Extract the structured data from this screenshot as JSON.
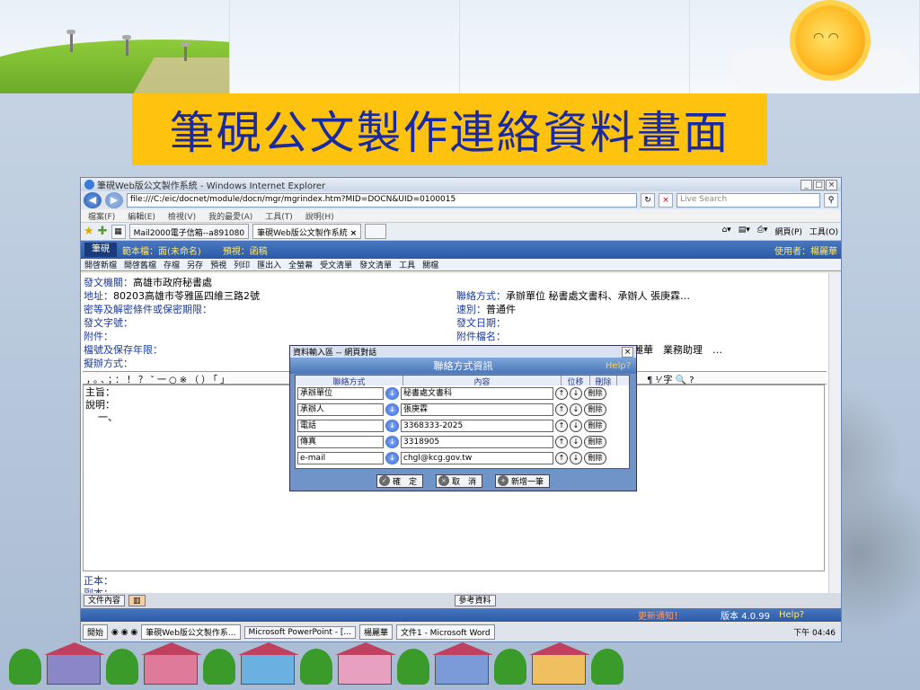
{
  "slide": {
    "title": "筆硯公文製作連絡資料畫面"
  },
  "browser": {
    "window_title": "筆硯Web版公文製作系統 - Windows Internet Explorer",
    "address": "file:///C:/eic/docnet/module/docn/mgr/mgrindex.htm?MID=DOCN&UID=0100015",
    "search_placeholder": "Live Search",
    "menu": [
      "檔案(F)",
      "編輯(E)",
      "檢視(V)",
      "我的最愛(A)",
      "工具(T)",
      "說明(H)"
    ],
    "tabs": [
      {
        "label": "Mail2000電子信箱--a891080"
      },
      {
        "label": "筆硯Web版公文製作系統"
      }
    ],
    "tab_close": "×",
    "right_commands": [
      "網頁(P)",
      "工具(O)"
    ]
  },
  "app": {
    "logo": "筆硯",
    "template_label": "範本檔：面(未命名)",
    "preview_label": "預視：函稿",
    "user_label": "使用者：楊麗華",
    "toolbar": [
      "開啓新檔",
      "開啓舊檔",
      "存檔",
      "另存",
      "預視",
      "列印",
      "匯出入",
      "全螢幕",
      "受文清單",
      "發文清單",
      "工具",
      "關檔"
    ]
  },
  "doc": {
    "issuer_label": "發文機關：",
    "issuer_value": "高雄市政府秘書處",
    "address_label": "地址：",
    "address_value": "80203高雄市苓雅區四維三路2號",
    "secret_label": "密等及解密條件或保密期限：",
    "doc_no_label": "發文字號：",
    "attach_label": "附件：",
    "file_no_label": "檔號及保存年限：",
    "process_label": "擬辦方式：",
    "contact_label": "聯絡方式：",
    "contact_value": "承辦單位 秘書處文書科、承辦人 張庚霖…",
    "speed_label": "速別：",
    "speed_value": "普通件",
    "date_label": "發文日期：",
    "attach_name_label": "附件檔名：",
    "signer_value": "麗華　業務助理　…",
    "punctuation": "，。、；：！？ˇ一○※（）「」",
    "subject_label": "主旨：",
    "explain_label": "說明：",
    "item_one": "一、",
    "cc_label": "正本：",
    "copy_label": "副本："
  },
  "bottom": {
    "content_tab": "文件內容",
    "reference_button": "參考資料"
  },
  "status": {
    "alert": "更新通知！",
    "version": "版本 4.0.99",
    "help": "Help?"
  },
  "taskbar": {
    "start": "開始",
    "items": [
      "筆硯Web版公文製作系...",
      "Microsoft PowerPoint - [...",
      "楊麗華",
      "文件1 - Microsoft Word"
    ],
    "clock": "下午 04:46"
  },
  "dialog": {
    "title": "資料輸入區 -- 網頁對話",
    "header": "聯絡方式資訊",
    "help": "Help?",
    "columns": [
      "聯絡方式",
      "內容",
      "位移",
      "刪除"
    ],
    "rows": [
      {
        "type": "承辦單位",
        "value": "秘書處文書科"
      },
      {
        "type": "承辦人",
        "value": "張庚霖"
      },
      {
        "type": "電話",
        "value": "3368333-2025"
      },
      {
        "type": "傳真",
        "value": "3318905"
      },
      {
        "type": "e-mail",
        "value": "chgl@kcg.gov.tw"
      }
    ],
    "delete_label": "刪除",
    "buttons": {
      "ok": "確　定",
      "cancel": "取　消",
      "add": "新增一筆"
    }
  }
}
